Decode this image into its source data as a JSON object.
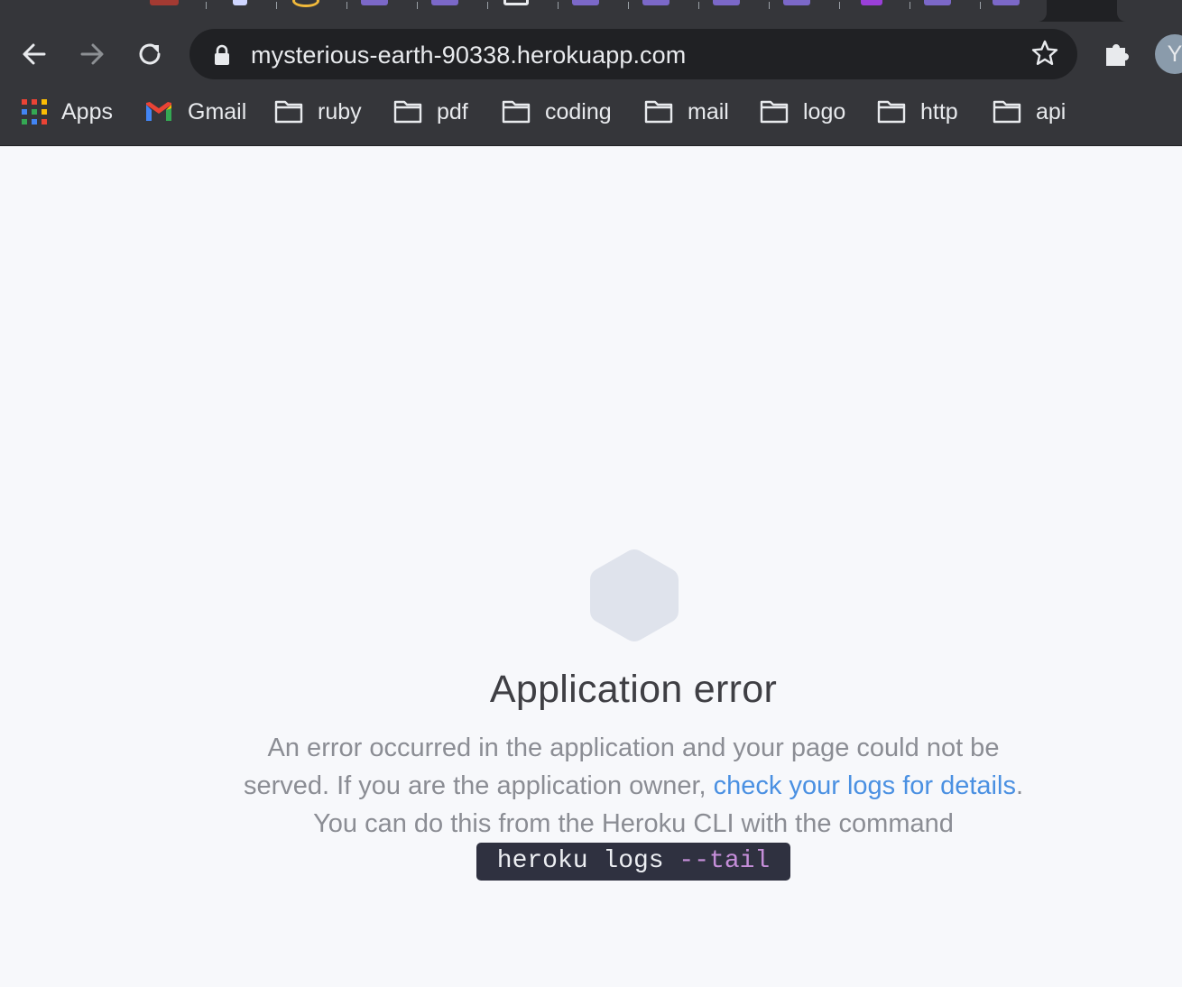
{
  "browser": {
    "url": "mysterious-earth-90338.herokuapp.com",
    "profile_initial": "Y",
    "bookmarks": [
      {
        "label": "Apps",
        "icon": "apps-grid-icon"
      },
      {
        "label": "Gmail",
        "icon": "gmail-icon"
      },
      {
        "label": "ruby",
        "icon": "folder-icon"
      },
      {
        "label": "pdf",
        "icon": "folder-icon"
      },
      {
        "label": "coding",
        "icon": "folder-icon"
      },
      {
        "label": "mail",
        "icon": "folder-icon"
      },
      {
        "label": "logo",
        "icon": "folder-icon"
      },
      {
        "label": "http",
        "icon": "folder-icon"
      },
      {
        "label": "api",
        "icon": "folder-icon"
      }
    ]
  },
  "error_page": {
    "title": "Application error",
    "body_part1": "An error occurred in the application and your page could not be served. If you are the application owner, ",
    "link_text": "check your logs for details",
    "body_part2": ". You can do this from the Heroku CLI with the command",
    "command_main": "heroku logs ",
    "command_flag": "--tail"
  },
  "colors": {
    "chrome_bg": "#35363a",
    "omnibox_bg": "#202124",
    "page_bg": "#f7f8fb",
    "link": "#4a90e2",
    "hexagon": "#dfe3ec",
    "command_bg": "#2f3140",
    "command_flag": "#c58ed9"
  }
}
